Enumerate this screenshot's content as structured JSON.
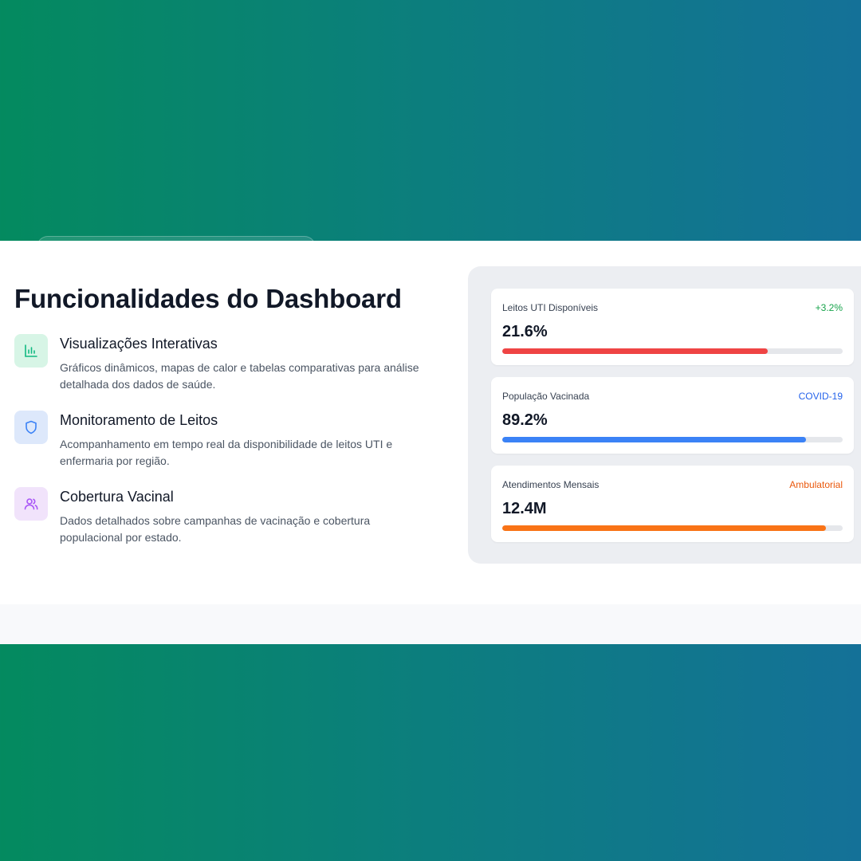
{
  "section": {
    "title": "Funcionalidades do Dashboard"
  },
  "features": [
    {
      "icon": "bar-chart-icon",
      "title": "Visualizações Interativas",
      "description": "Gráficos dinâmicos, mapas de calor e tabelas comparativas para análise detalhada dos dados de saúde."
    },
    {
      "icon": "shield-icon",
      "title": "Monitoramento de Leitos",
      "description": "Acompanhamento em tempo real da disponibilidade de leitos UTI e enfermaria por região."
    },
    {
      "icon": "users-icon",
      "title": "Cobertura Vacinal",
      "description": "Dados detalhados sobre campanhas de vacinação e cobertura populacional por estado."
    }
  ],
  "metrics": [
    {
      "label": "Leitos UTI Disponíveis",
      "tag": "+3.2%",
      "tag_color": "#16a34a",
      "value": "21.6%",
      "progress": 0.78,
      "bar_color": "#ef4444"
    },
    {
      "label": "População Vacinada",
      "tag": "COVID-19",
      "tag_color": "#2563eb",
      "value": "89.2%",
      "progress": 0.892,
      "bar_color": "#3b82f6"
    },
    {
      "label": "Atendimentos Mensais",
      "tag": "Ambulatorial",
      "tag_color": "#ea580c",
      "value": "12.4M",
      "progress": 0.95,
      "bar_color": "#f97316"
    }
  ],
  "colors": {
    "gradient_start": "#048a5f",
    "gradient_end": "#147198",
    "icon_green": "#10b981",
    "icon_blue": "#3b82f6",
    "icon_purple": "#a855f7"
  }
}
